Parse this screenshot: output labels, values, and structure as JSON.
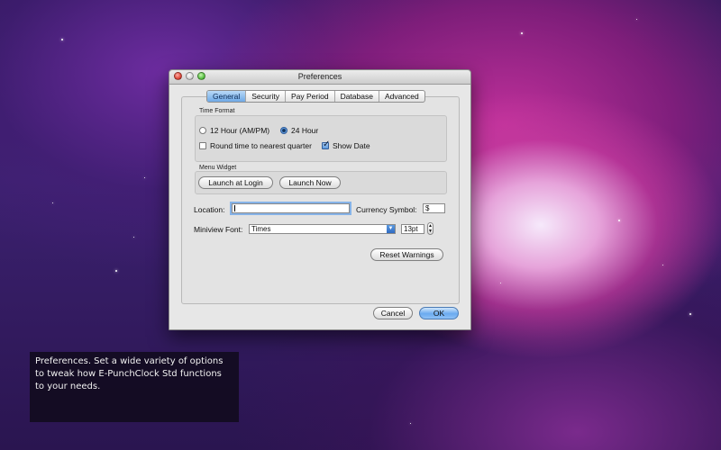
{
  "window": {
    "title": "Preferences"
  },
  "tabs": [
    {
      "label": "General",
      "active": true
    },
    {
      "label": "Security",
      "active": false
    },
    {
      "label": "Pay Period",
      "active": false
    },
    {
      "label": "Database",
      "active": false
    },
    {
      "label": "Advanced",
      "active": false
    }
  ],
  "time_format": {
    "group_label": "Time Format",
    "option_12h": "12 Hour (AM/PM)",
    "option_24h": "24 Hour",
    "selected": "24 Hour",
    "round_label": "Round time to nearest quarter",
    "round_checked": false,
    "show_date_label": "Show Date",
    "show_date_checked": true
  },
  "menu_widget": {
    "group_label": "Menu Widget",
    "launch_at_login": "Launch at Login",
    "launch_now": "Launch Now"
  },
  "location": {
    "label": "Location:",
    "value": ""
  },
  "currency": {
    "label": "Currency Symbol:",
    "value": "$"
  },
  "miniview_font": {
    "label": "Miniview Font:",
    "value": "Times",
    "size": "13pt"
  },
  "buttons": {
    "reset_warnings": "Reset Warnings",
    "cancel": "Cancel",
    "ok": "OK"
  },
  "caption": {
    "text": "Preferences. Set a wide variety of options to tweak how E-PunchClock Std functions to your needs."
  },
  "colors": {
    "accent": "#6ea9e6",
    "window_bg": "#e7e7e7"
  }
}
